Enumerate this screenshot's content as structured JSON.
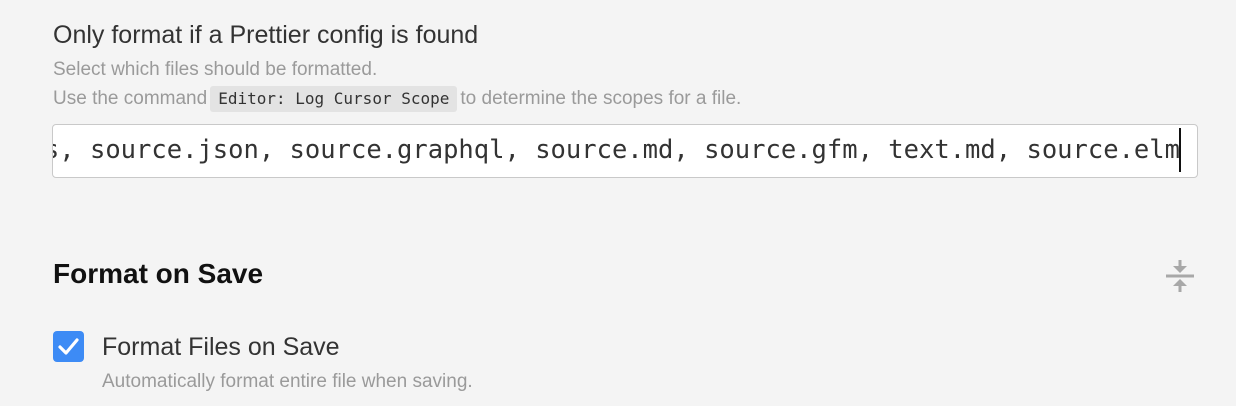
{
  "prettier_config": {
    "title": "Only format if a Prettier config is found",
    "description_line1": "Select which files should be formatted.",
    "description_prefix": "Use the command",
    "command": "Editor: Log Cursor Scope",
    "description_suffix": "to determine the scopes for a file.",
    "scopes_value": "source.js, source.jsx, source.js.jsx, source.babel, source.js-semantic, text.html.basic, text.html.vue, source.ts, source.tsx, source.flow, source.css, source.css.less, source.css.scss, source.json, source.graphql, source.md, source.gfm, text.md, source.elm"
  },
  "format_on_save": {
    "section_title": "Format on Save",
    "collapse_icon": "collapse-icon",
    "checkbox_checked": true,
    "checkbox_label": "Format Files on Save",
    "checkbox_description": "Automatically format entire file when saving."
  },
  "colors": {
    "background": "#f4f4f4",
    "accent": "#3d8bf5",
    "muted_text": "#9a9a9a"
  }
}
